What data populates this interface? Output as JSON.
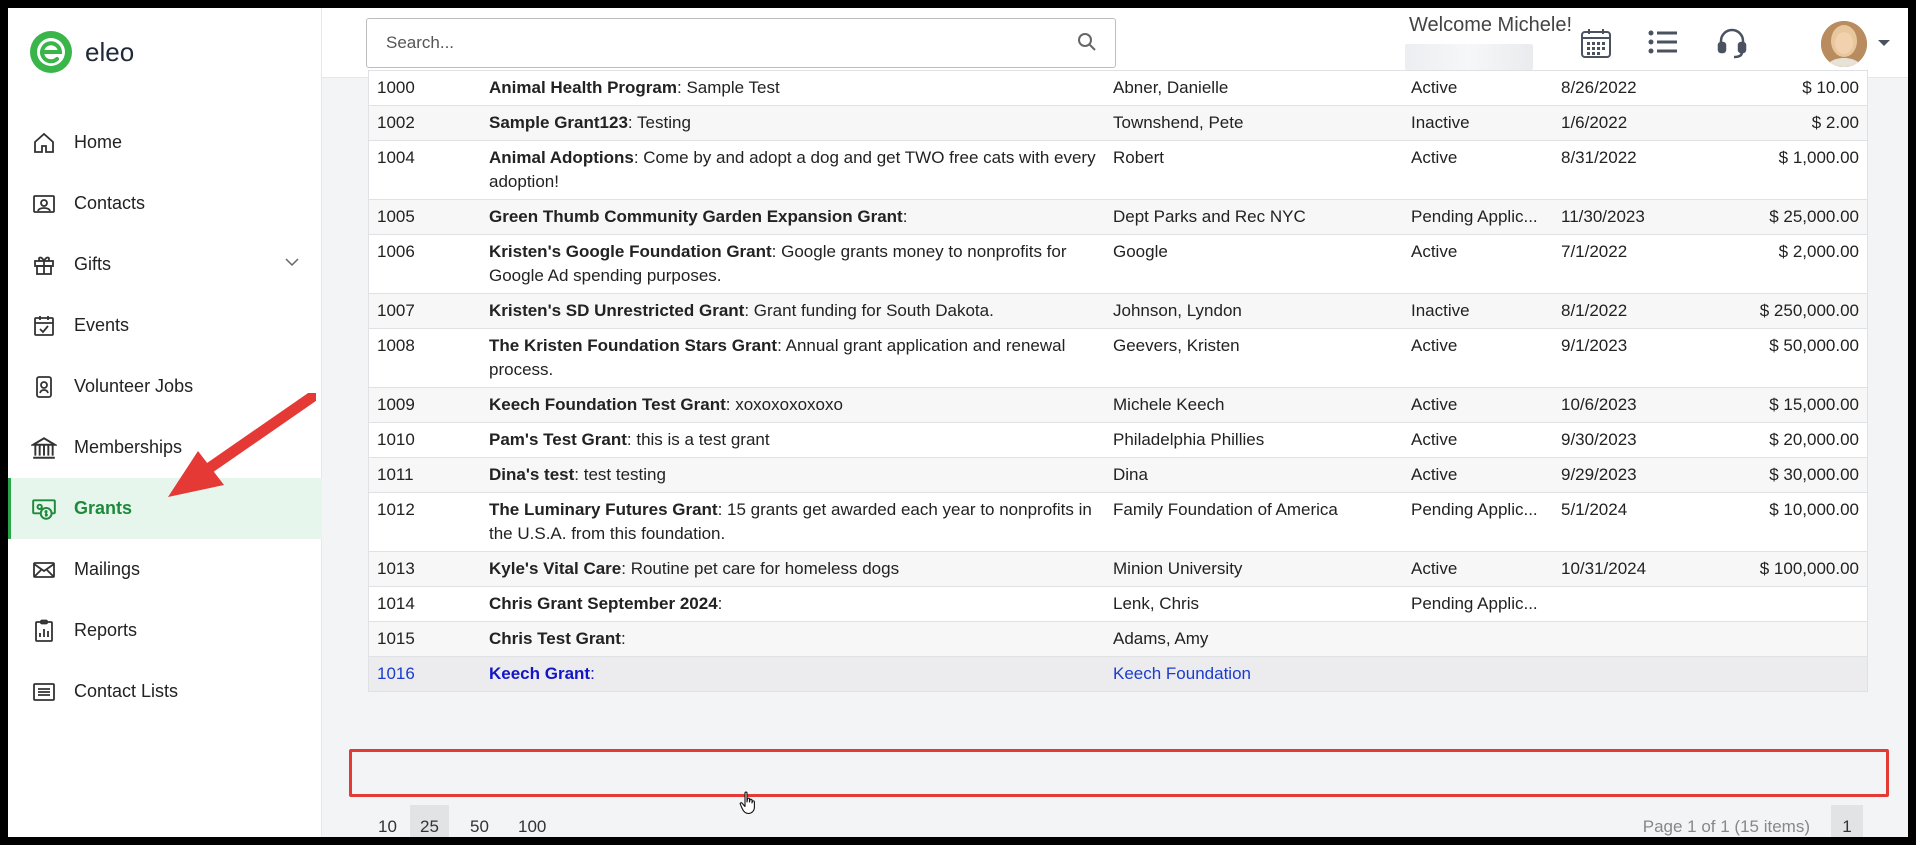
{
  "app": {
    "logo_text": "eleo",
    "brand_color": "#2aa54a",
    "accent_red": "#e53935"
  },
  "sidebar": {
    "items": [
      {
        "label": "Home",
        "icon": "home-icon"
      },
      {
        "label": "Contacts",
        "icon": "contact-card-icon"
      },
      {
        "label": "Gifts",
        "icon": "gift-icon",
        "expandable": true
      },
      {
        "label": "Events",
        "icon": "calendar-check-icon"
      },
      {
        "label": "Volunteer Jobs",
        "icon": "volunteer-badge-icon"
      },
      {
        "label": "Memberships",
        "icon": "building-columns-icon"
      },
      {
        "label": "Grants",
        "icon": "grant-money-icon",
        "active": true
      },
      {
        "label": "Mailings",
        "icon": "envelope-icon"
      },
      {
        "label": "Reports",
        "icon": "report-clipboard-icon"
      },
      {
        "label": "Contact Lists",
        "icon": "list-icon"
      }
    ]
  },
  "header": {
    "search_placeholder": "Search...",
    "welcome": "Welcome Michele!",
    "icons": [
      "calendar-grid-icon",
      "task-list-icon",
      "headset-icon",
      "user-avatar",
      "chevron-down-icon"
    ]
  },
  "grants": {
    "rows": [
      {
        "id": "1000",
        "name": "Animal Health Program",
        "desc": "Sample Test",
        "contact": "Abner, Danielle",
        "status": "Active",
        "date": "8/26/2022",
        "amount": "$ 10.00"
      },
      {
        "id": "1002",
        "name": "Sample Grant123",
        "desc": "Testing",
        "contact": "Townshend, Pete",
        "status": "Inactive",
        "date": "1/6/2022",
        "amount": "$ 2.00"
      },
      {
        "id": "1004",
        "name": "Animal Adoptions",
        "desc": "Come by and adopt a dog and get TWO free cats with every adoption!",
        "contact": "Robert",
        "status": "Active",
        "date": "8/31/2022",
        "amount": "$ 1,000.00"
      },
      {
        "id": "1005",
        "name": "Green Thumb Community Garden Expansion Grant",
        "desc": "",
        "contact": "Dept Parks and Rec NYC",
        "status": "Pending Applic...",
        "date": "11/30/2023",
        "amount": "$ 25,000.00"
      },
      {
        "id": "1006",
        "name": "Kristen's Google Foundation Grant",
        "desc": "Google grants money to nonprofits for Google Ad spending purposes.",
        "contact": "Google",
        "status": "Active",
        "date": "7/1/2022",
        "amount": "$ 2,000.00"
      },
      {
        "id": "1007",
        "name": "Kristen's SD Unrestricted Grant",
        "desc": "Grant funding for South Dakota.",
        "contact": "Johnson, Lyndon",
        "status": "Inactive",
        "date": "8/1/2022",
        "amount": "$ 250,000.00"
      },
      {
        "id": "1008",
        "name": "The Kristen Foundation Stars Grant",
        "desc": "Annual grant application and renewal process.",
        "contact": "Geevers, Kristen",
        "status": "Active",
        "date": "9/1/2023",
        "amount": "$ 50,000.00"
      },
      {
        "id": "1009",
        "name": "Keech Foundation Test Grant",
        "desc": "xoxoxoxoxoxo",
        "contact": "Michele Keech",
        "status": "Active",
        "date": "10/6/2023",
        "amount": "$ 15,000.00"
      },
      {
        "id": "1010",
        "name": "Pam's Test Grant",
        "desc": "this is a test grant",
        "contact": "Philadelphia Phillies",
        "status": "Active",
        "date": "9/30/2023",
        "amount": "$ 20,000.00"
      },
      {
        "id": "1011",
        "name": "Dina's test",
        "desc": "test testing",
        "contact": "Dina",
        "status": "Active",
        "date": "9/29/2023",
        "amount": "$ 30,000.00"
      },
      {
        "id": "1012",
        "name": "The Luminary Futures Grant",
        "desc": "15 grants get awarded each year to nonprofits in the U.S.A. from this foundation.",
        "contact": "Family Foundation of America",
        "status": "Pending Applic...",
        "date": "5/1/2024",
        "amount": "$ 10,000.00"
      },
      {
        "id": "1013",
        "name": "Kyle's Vital Care",
        "desc": "Routine pet care for homeless dogs",
        "contact": "Minion University",
        "status": "Active",
        "date": "10/31/2024",
        "amount": "$ 100,000.00"
      },
      {
        "id": "1014",
        "name": "Chris Grant September 2024",
        "desc": "",
        "contact": "Lenk, Chris",
        "status": "Pending Applic...",
        "date": "",
        "amount": ""
      },
      {
        "id": "1015",
        "name": "Chris Test Grant",
        "desc": "",
        "contact": "Adams, Amy",
        "status": "",
        "date": "",
        "amount": ""
      },
      {
        "id": "1016",
        "name": "Keech Grant",
        "desc": "",
        "contact": "Keech Foundation",
        "status": "",
        "date": "",
        "amount": "",
        "hover": true
      }
    ]
  },
  "pager": {
    "sizes": [
      "10",
      "25",
      "50",
      "100"
    ],
    "selected_size": "25",
    "info": "Page 1 of 1 (15 items)",
    "page": "1"
  }
}
